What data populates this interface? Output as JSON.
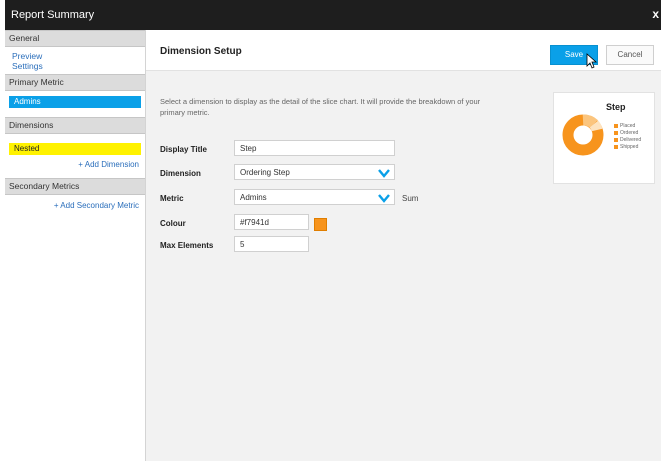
{
  "window": {
    "title": "Report Summary",
    "close_glyph": "x"
  },
  "sidebar": {
    "general": {
      "header": "General",
      "links": [
        "Preview",
        "Settings"
      ]
    },
    "primary_metric": {
      "header": "Primary Metric",
      "pill": "Admins"
    },
    "dimensions": {
      "header": "Dimensions",
      "pill": "Nested",
      "add_link": "+ Add Dimension"
    },
    "secondary_metrics": {
      "header": "Secondary Metrics",
      "add_link": "+ Add Secondary Metric"
    }
  },
  "main": {
    "title": "Dimension Setup",
    "save_label": "Save",
    "cancel_label": "Cancel",
    "description": "Select a dimension to display as the detail of the slice chart. It will provide the breakdown of your primary metric.",
    "fields": {
      "display_title": {
        "label": "Display Title",
        "value": "Step"
      },
      "dimension": {
        "label": "Dimension",
        "value": "Ordering Step"
      },
      "metric": {
        "label": "Metric",
        "value": "Admins",
        "aggregation": "Sum"
      },
      "colour": {
        "label": "Colour",
        "value": "#f7941d"
      },
      "max_elements": {
        "label": "Max Elements",
        "value": "5"
      }
    },
    "preview": {
      "title": "Step",
      "legend": [
        "Placed",
        "Ordered",
        "Delivered",
        "Shipped"
      ]
    }
  },
  "colors": {
    "accent": "#0aa0e8",
    "highlight": "#fff200",
    "orange": "#f7941d"
  }
}
